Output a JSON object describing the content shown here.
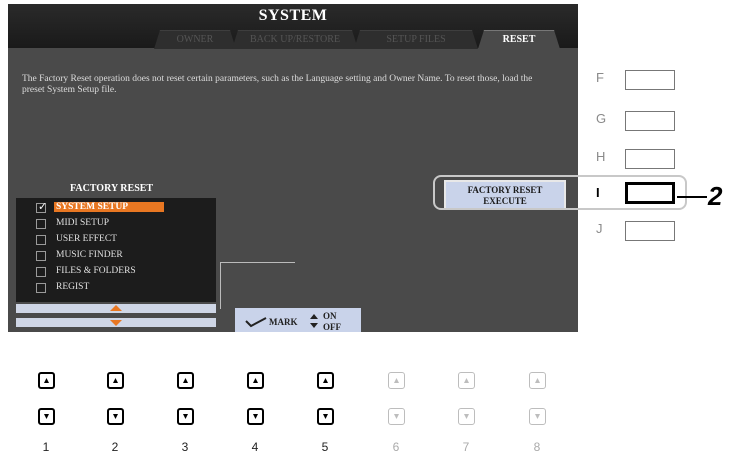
{
  "screen": {
    "title": "SYSTEM",
    "tabs": [
      {
        "label": "OWNER"
      },
      {
        "label": "BACK UP/RESTORE"
      },
      {
        "label": "SETUP FILES"
      },
      {
        "label": "RESET",
        "active": true
      }
    ],
    "info_text": "The Factory Reset operation does not reset certain parameters, such as the Language setting and Owner Name. To reset those, load the preset System Setup file.",
    "factory_reset": {
      "heading": "FACTORY RESET",
      "items": [
        {
          "label": "SYSTEM SETUP",
          "checked": true,
          "selected": true
        },
        {
          "label": "MIDI SETUP",
          "checked": false
        },
        {
          "label": "USER EFFECT",
          "checked": false
        },
        {
          "label": "MUSIC FINDER",
          "checked": false
        },
        {
          "label": "FILES & FOLDERS",
          "checked": false
        },
        {
          "label": "REGIST",
          "checked": false
        }
      ]
    },
    "execute_button": {
      "line1": "FACTORY RESET",
      "line2": "EXECUTE"
    },
    "mark_bar": {
      "mark_label": "MARK",
      "on_label": "ON",
      "off_label": "OFF"
    }
  },
  "side_buttons": [
    {
      "letter": "F"
    },
    {
      "letter": "G"
    },
    {
      "letter": "H"
    },
    {
      "letter": "I",
      "active": true
    },
    {
      "letter": "J"
    }
  ],
  "step_callout": "2",
  "bottom_buttons": [
    {
      "number": "1",
      "enabled": true
    },
    {
      "number": "2",
      "enabled": true
    },
    {
      "number": "3",
      "enabled": true
    },
    {
      "number": "4",
      "enabled": true
    },
    {
      "number": "5",
      "enabled": true
    },
    {
      "number": "6",
      "enabled": false
    },
    {
      "number": "7",
      "enabled": false
    },
    {
      "number": "8",
      "enabled": false
    }
  ],
  "colors": {
    "screen_bg": "#4a4a4a",
    "selection": "#e87722",
    "button_face": "#c9d3ea"
  }
}
